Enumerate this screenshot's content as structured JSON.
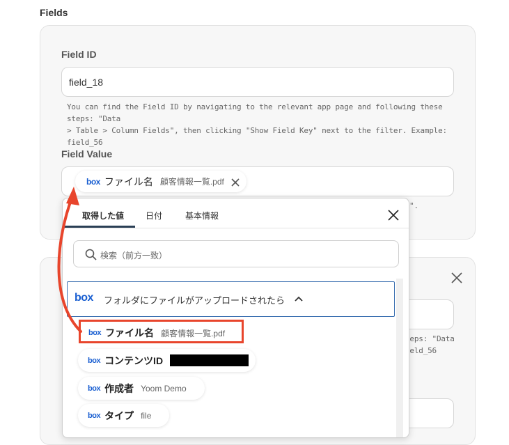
{
  "section": {
    "title": "Fields"
  },
  "field_id": {
    "label": "Field ID",
    "value": "field_18",
    "help_line1": "You can find the Field ID by navigating to the relevant app page and following these steps: \"Data",
    "help_line2": "> Table > Column Fields\", then clicking \"Show Field Key\" next to the filter. Example: field_56"
  },
  "field_value": {
    "label": "Field Value",
    "chip": {
      "logo": "box",
      "name": "ファイル名",
      "value": "顧客情報一覧.pdf",
      "remove_icon": "close-icon"
    },
    "help_partial": "\"."
  },
  "card2": {
    "help_partial_line1": "teps: \"Data",
    "help_partial_line2": "ield_56"
  },
  "popup": {
    "tabs": [
      "取得した値",
      "日付",
      "基本情報"
    ],
    "active_tab": 0,
    "search_placeholder": "検索（前方一致）",
    "group": {
      "logo": "box",
      "title": "フォルダにファイルがアップロードされたら"
    },
    "items": [
      {
        "logo": "box",
        "name": "ファイル名",
        "value": "顧客情報一覧.pdf",
        "highlighted": true
      },
      {
        "logo": "box",
        "name": "コンテンツID",
        "value": "",
        "redacted": true
      },
      {
        "logo": "box",
        "name": "作成者",
        "value": "Yoom Demo"
      },
      {
        "logo": "box",
        "name": "タイプ",
        "value": "file"
      }
    ]
  },
  "colors": {
    "annotation_red": "#e8452c",
    "box_blue": "#1a5fd1",
    "tab_underline": "#2a3f55",
    "group_border": "#3a6fb0"
  }
}
